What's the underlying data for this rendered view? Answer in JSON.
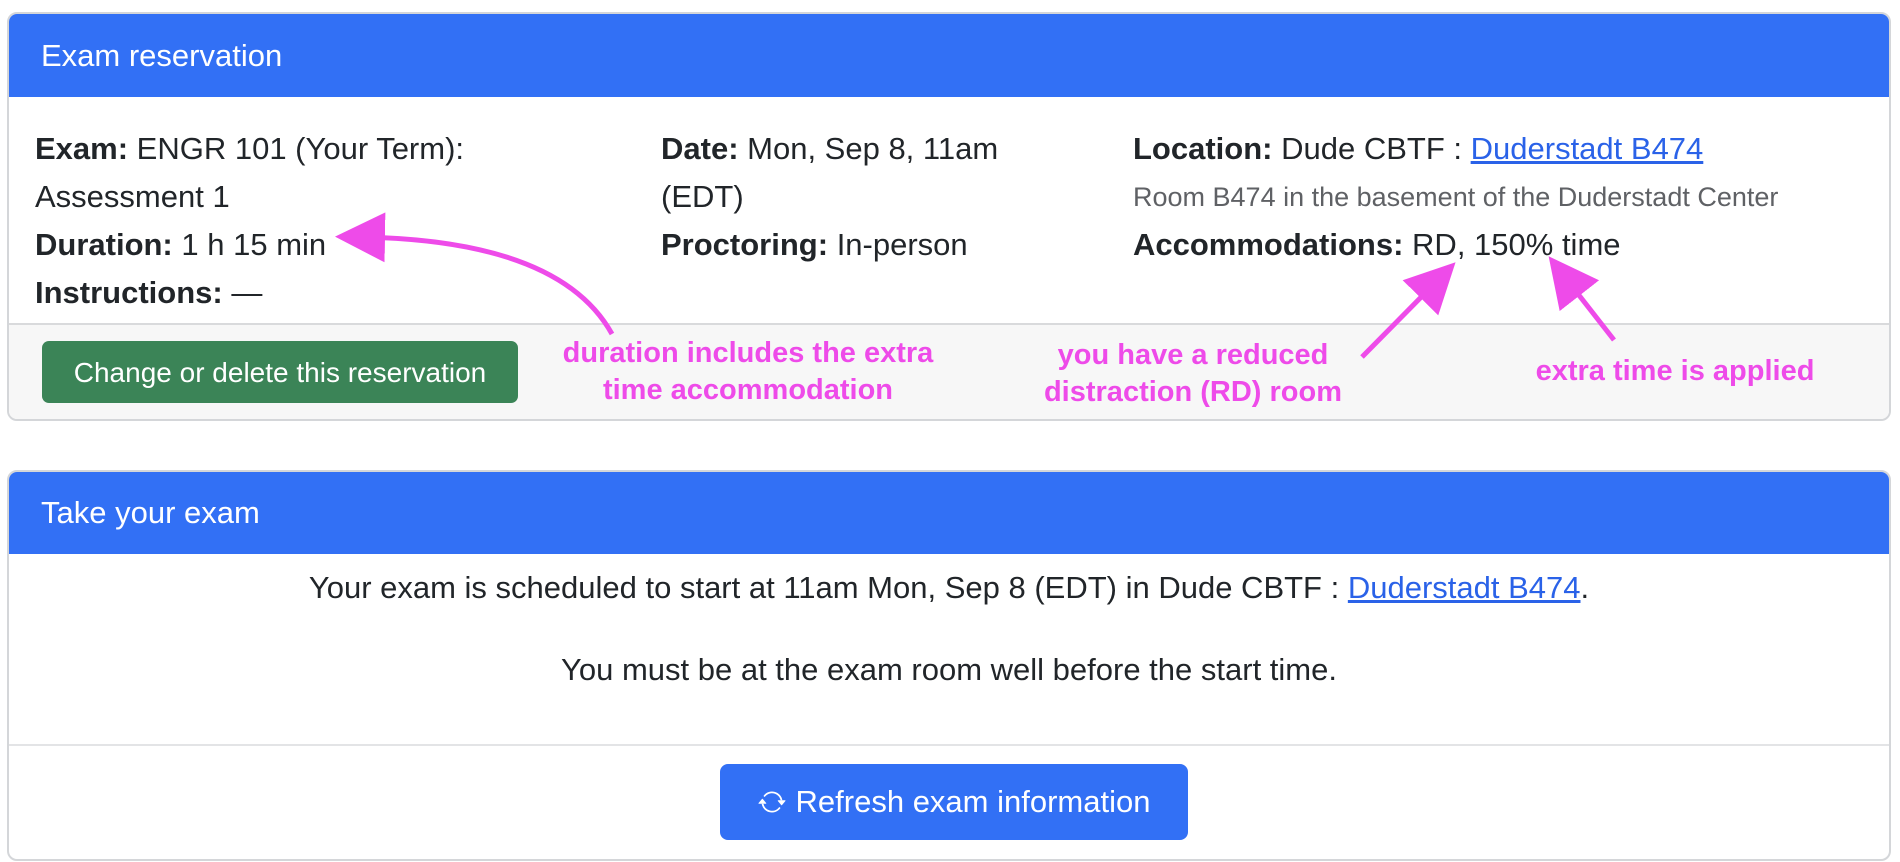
{
  "reservation_card": {
    "title": "Exam reservation",
    "exam_label": "Exam:",
    "exam_value": "ENGR 101 (Your Term): Assessment 1",
    "duration_label": "Duration:",
    "duration_value": "1 h 15 min",
    "instructions_label": "Instructions:",
    "instructions_value": "—",
    "date_label": "Date:",
    "date_value": "Mon, Sep 8, 11am (EDT)",
    "proctoring_label": "Proctoring:",
    "proctoring_value": "In-person",
    "location_label": "Location:",
    "location_center": "Dude CBTF :",
    "location_link": "Duderstadt B474",
    "room_description": "Room B474 in the basement of the Duderstadt Center",
    "accommodations_label": "Accommodations:",
    "accommodations_value": "RD, 150% time",
    "change_button": "Change or delete this reservation"
  },
  "annotations": {
    "duration_line1": "duration includes the extra",
    "duration_line2": "time accommodation",
    "rd_line1": "you have a reduced",
    "rd_line2": "distraction (RD) room",
    "extra_time": "extra time is applied",
    "color": "#ee4be9"
  },
  "take_card": {
    "title": "Take your exam",
    "schedule_text": "Your exam is scheduled to start at 11am Mon, Sep 8 (EDT) in Dude CBTF :",
    "location_link": "Duderstadt B474",
    "schedule_end": ".",
    "arrival_text": "You must be at the exam room well before the start time.",
    "refresh_button": "Refresh exam information",
    "refresh_icon": "refresh-icon"
  },
  "colors": {
    "header_blue": "#3270f5",
    "button_green": "#3b8457",
    "link_blue": "#2a62e8"
  }
}
